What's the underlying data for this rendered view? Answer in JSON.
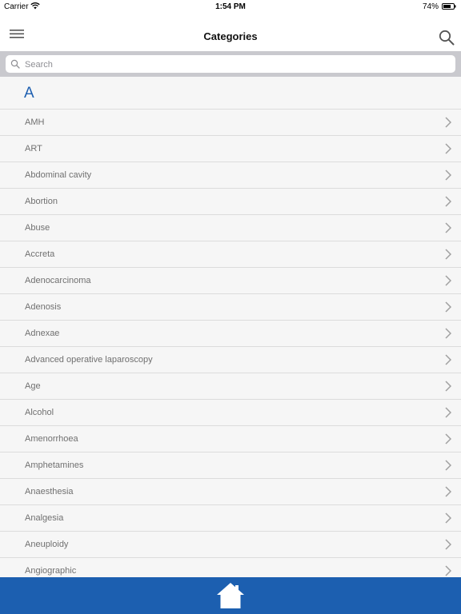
{
  "status": {
    "carrier": "Carrier",
    "time": "1:54 PM",
    "battery": "74%"
  },
  "navbar": {
    "title": "Categories"
  },
  "search": {
    "placeholder": "Search"
  },
  "section": {
    "letter": "A"
  },
  "items": [
    "AMH",
    "ART",
    "Abdominal cavity",
    "Abortion",
    "Abuse",
    "Accreta",
    "Adenocarcinoma",
    "Adenosis",
    "Adnexae",
    "Advanced operative laparoscopy",
    "Age",
    "Alcohol",
    "Amenorrhoea",
    "Amphetamines",
    "Anaesthesia",
    "Analgesia",
    "Aneuploidy",
    "Angiographic"
  ],
  "colors": {
    "accent": "#1d5fb0",
    "bottom_bar": "#1c5fb0",
    "search_bar_bg": "#c9c9ce"
  },
  "icons": {
    "menu": "hamburger-icon",
    "search": "search-icon",
    "row": "chevron-right-icon",
    "home": "home-icon"
  }
}
